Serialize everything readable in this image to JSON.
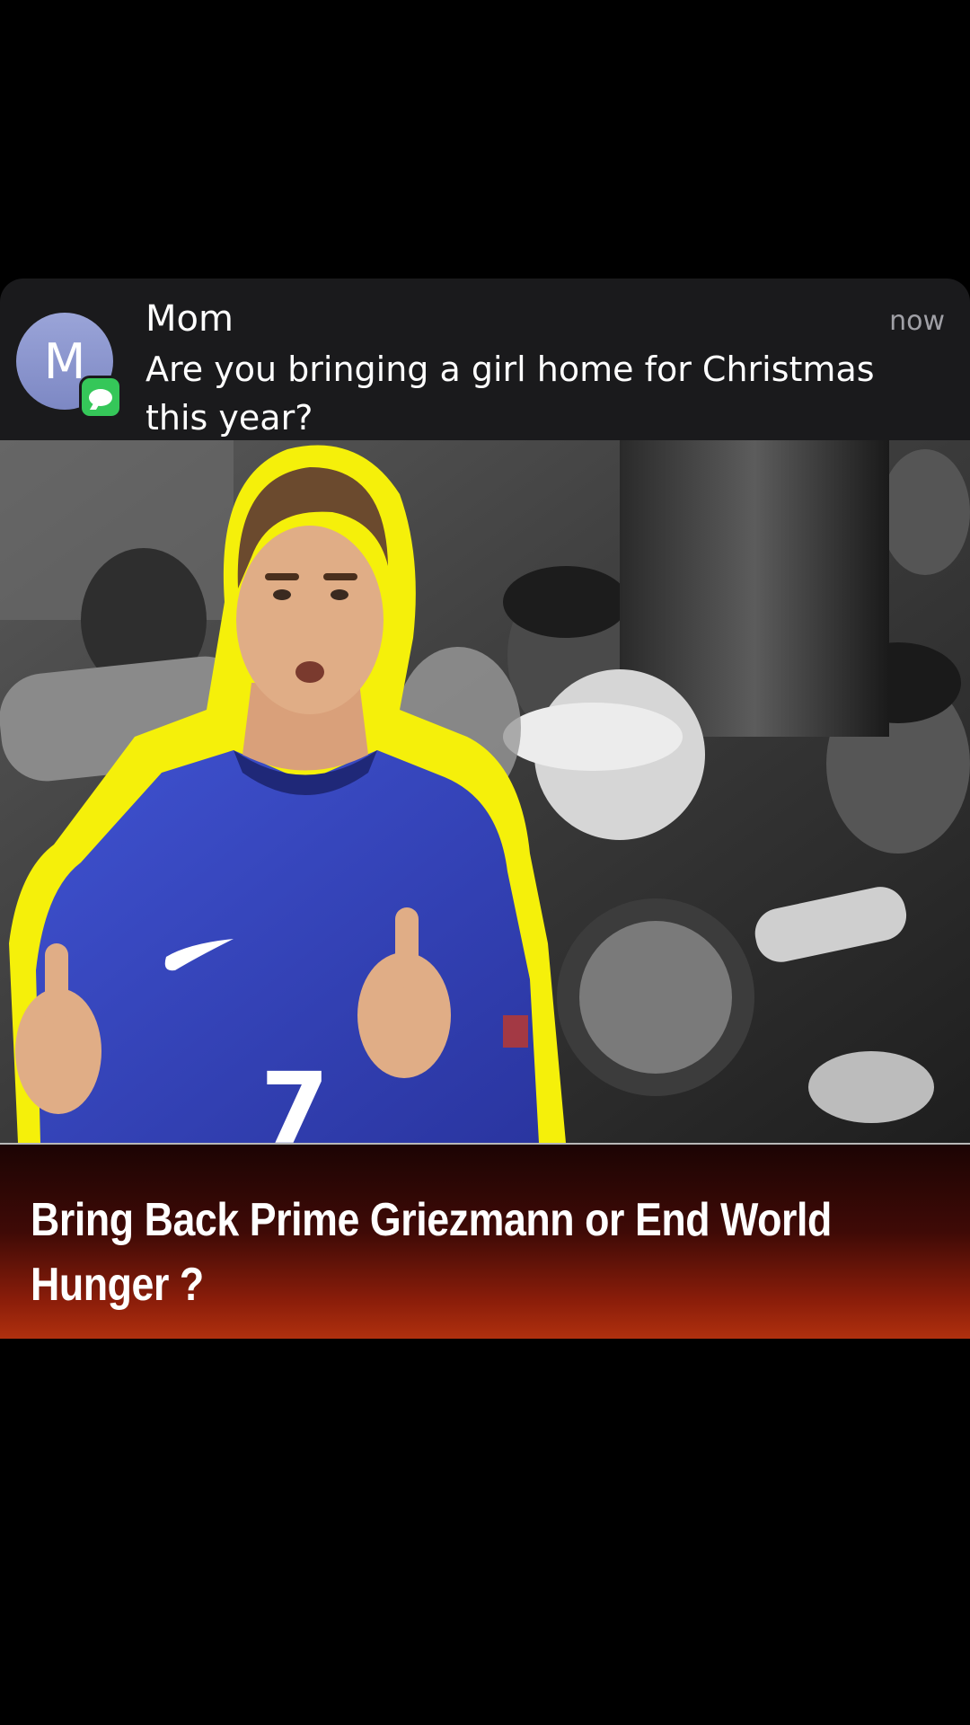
{
  "notification": {
    "avatar_letter": "M",
    "app_badge_icon": "messages-app-icon",
    "sender": "Mom",
    "time": "now",
    "message": "Are you bringing a girl home for Christmas this year?"
  },
  "thumbnail": {
    "image": "footballer-in-blue-number-7-jersey-with-yellow-outline-over-black-and-white-crowd-holding-bowls",
    "jersey_number": "7"
  },
  "caption": {
    "text": "Bring Back Prime Griezmann or End World Hunger ?"
  },
  "colors": {
    "background": "#000000",
    "notification_bg": "#1a1a1c",
    "avatar": "#8c96d0",
    "badge": "#35c759",
    "outline": "#f5f00a",
    "jersey": "#3a4bc4",
    "caption_gradient_end": "#b0300e"
  }
}
